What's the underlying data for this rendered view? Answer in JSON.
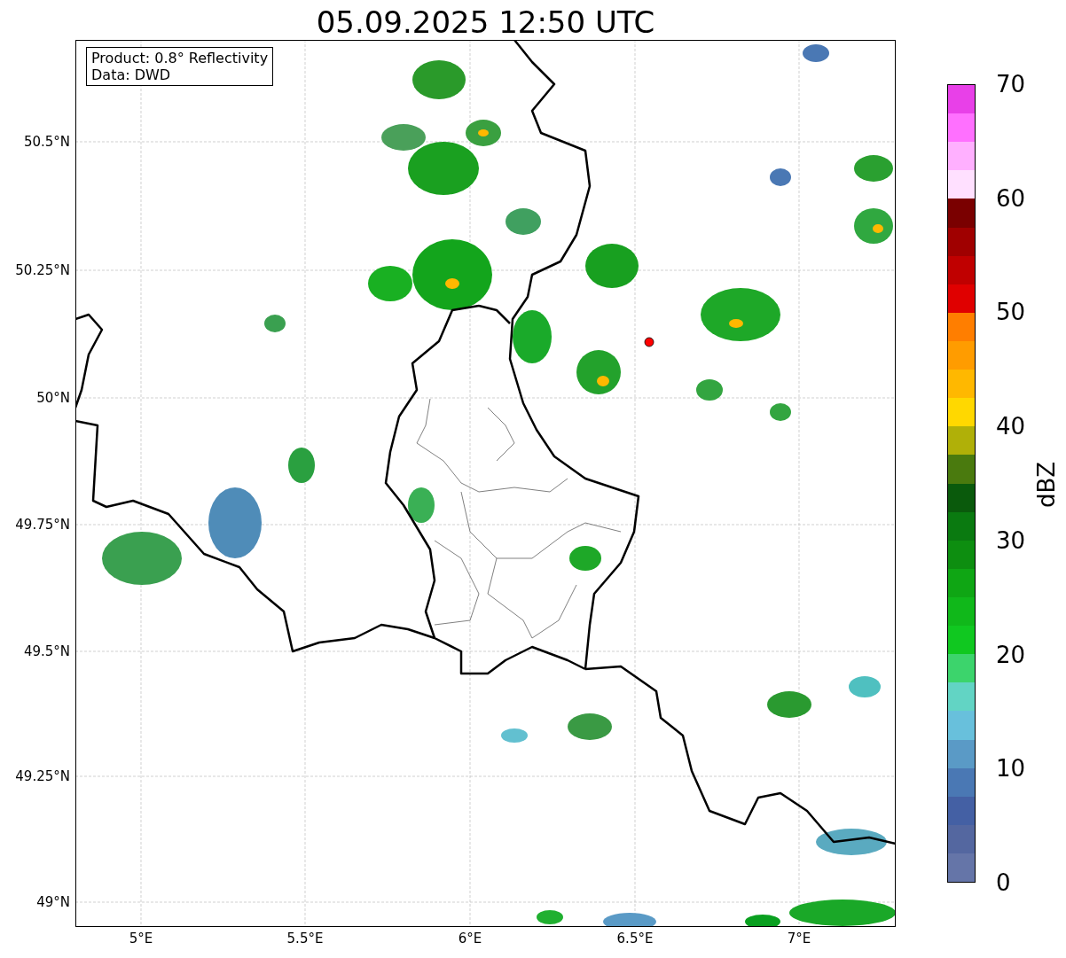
{
  "title": "05.09.2025 12:50 UTC",
  "legend": [
    "Product: 0.8° Reflectivity",
    "Data: DWD"
  ],
  "y_ticks": [
    "50.5°N",
    "50.25°N",
    "50°N",
    "49.75°N",
    "49.5°N",
    "49.25°N",
    "49°N"
  ],
  "x_ticks": [
    "5°E",
    "5.5°E",
    "6°E",
    "6.5°E",
    "7°E"
  ],
  "colorbar": {
    "label": "dBZ",
    "ticks": [
      "70",
      "60",
      "50",
      "40",
      "30",
      "20",
      "10",
      "0"
    ],
    "bins": [
      {
        "color": "#e840e8"
      },
      {
        "color": "#ff70ff"
      },
      {
        "color": "#ffb0ff"
      },
      {
        "color": "#ffe0ff"
      },
      {
        "color": "#7a0000"
      },
      {
        "color": "#a00000"
      },
      {
        "color": "#c00000"
      },
      {
        "color": "#e00000"
      },
      {
        "color": "#ff7e00"
      },
      {
        "color": "#ff9c00"
      },
      {
        "color": "#ffb800"
      },
      {
        "color": "#ffd800"
      },
      {
        "color": "#b0b008"
      },
      {
        "color": "#4a7a0e"
      },
      {
        "color": "#0a5a0c"
      },
      {
        "color": "#0a7a10"
      },
      {
        "color": "#0d8e10"
      },
      {
        "color": "#0fa614"
      },
      {
        "color": "#10b81a"
      },
      {
        "color": "#10c820"
      },
      {
        "color": "#3cd46c"
      },
      {
        "color": "#62d4c4"
      },
      {
        "color": "#68c0dc"
      },
      {
        "color": "#5a9ac6"
      },
      {
        "color": "#4a78b4"
      },
      {
        "color": "#4460a4"
      },
      {
        "color": "#5467a0"
      },
      {
        "color": "#6575a8"
      }
    ]
  }
}
